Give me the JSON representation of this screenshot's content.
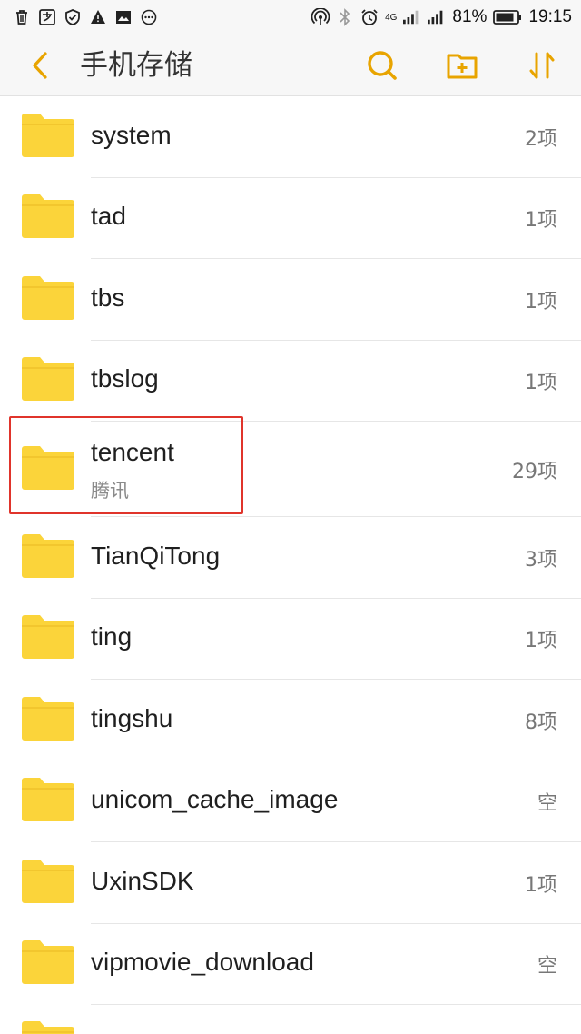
{
  "status_bar": {
    "network": "4G",
    "battery": "81%",
    "time": "19:15"
  },
  "app_bar": {
    "title": "手机存储",
    "accent_color": "#E8A400"
  },
  "folder_color": "#FBD43A",
  "highlight_color": "#E0342B",
  "items": [
    {
      "name": "system",
      "subtitle": "",
      "count": "2项"
    },
    {
      "name": "tad",
      "subtitle": "",
      "count": "1项"
    },
    {
      "name": "tbs",
      "subtitle": "",
      "count": "1项"
    },
    {
      "name": "tbslog",
      "subtitle": "",
      "count": "1项"
    },
    {
      "name": "tencent",
      "subtitle": "腾讯",
      "count": "29项"
    },
    {
      "name": "TianQiTong",
      "subtitle": "",
      "count": "3项"
    },
    {
      "name": "ting",
      "subtitle": "",
      "count": "1项"
    },
    {
      "name": "tingshu",
      "subtitle": "",
      "count": "8项"
    },
    {
      "name": "unicom_cache_image",
      "subtitle": "",
      "count": "空"
    },
    {
      "name": "UxinSDK",
      "subtitle": "",
      "count": "1项"
    },
    {
      "name": "vipmovie_download",
      "subtitle": "",
      "count": "空"
    }
  ]
}
